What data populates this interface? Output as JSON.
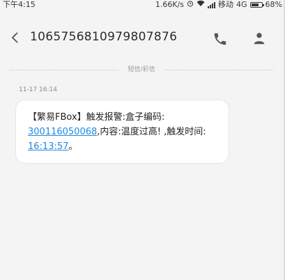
{
  "status_bar": {
    "time": "下午4:15",
    "speed": "1.66K/s",
    "carrier": "移动",
    "network": "4G",
    "battery_percent": "68%",
    "battery_level": 0.68
  },
  "header": {
    "title": "1065756810979807876",
    "icons": [
      "back-icon",
      "phone-icon",
      "contact-icon"
    ]
  },
  "conversation": {
    "channel_label": "短信/彩信",
    "message_time": "11-17 16:14",
    "message": {
      "part1": "【繁易FBox】触发报警:盒子编码:",
      "link_box_code": "300116050068",
      "part2": ",内容:温度过高! ,触发时间:",
      "link_time": "16:13:57",
      "part3": "。"
    }
  },
  "colors": {
    "background": "#f4f4f4",
    "bubble": "#ffffff",
    "link": "#1e88e5"
  }
}
